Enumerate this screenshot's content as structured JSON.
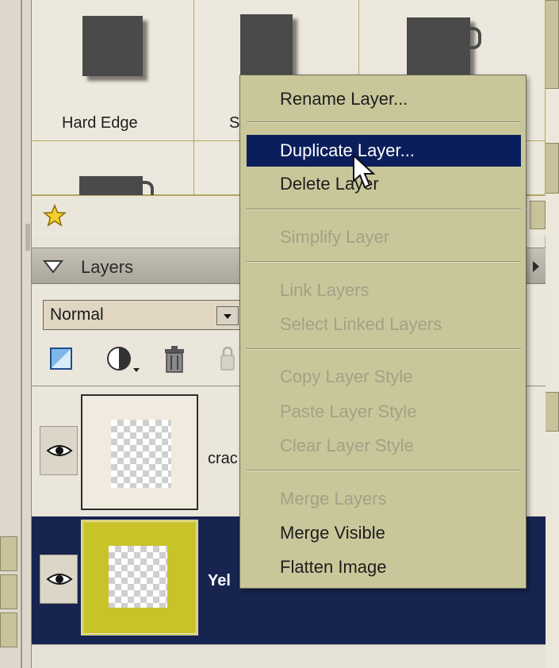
{
  "styles_panel": {
    "items": [
      {
        "label": "Hard Edge"
      },
      {
        "label": "S"
      },
      {
        "label": ""
      }
    ]
  },
  "layers_panel": {
    "title": "Layers",
    "blend_mode": "Normal",
    "tool_icons": [
      "new-layer-icon",
      "adjustment-layer-icon",
      "trash-icon",
      "lock-icon"
    ],
    "layers": [
      {
        "name": "crac",
        "visible": true,
        "selected": false
      },
      {
        "name": "Yel",
        "visible": true,
        "selected": true
      }
    ]
  },
  "context_menu": {
    "items": [
      {
        "label": "Rename Layer...",
        "enabled": true
      },
      {
        "label": "Duplicate Layer...",
        "enabled": true,
        "highlighted": true
      },
      {
        "label": "Delete Layer",
        "enabled": true
      },
      {
        "label": "Simplify Layer",
        "enabled": false
      },
      {
        "label": "Link Layers",
        "enabled": false
      },
      {
        "label": "Select Linked Layers",
        "enabled": false
      },
      {
        "label": "Copy Layer Style",
        "enabled": false
      },
      {
        "label": "Paste Layer Style",
        "enabled": false
      },
      {
        "label": "Clear Layer Style",
        "enabled": false
      },
      {
        "label": "Merge Layers",
        "enabled": false
      },
      {
        "label": "Merge Visible",
        "enabled": true
      },
      {
        "label": "Flatten Image",
        "enabled": true
      }
    ]
  },
  "colors": {
    "menu_bg": "#c9c79a",
    "highlight": "#0b1e5c",
    "selected_row": "#17244f",
    "grid_line": "#b3a75a",
    "layer_thumb_yellow": "#c9c32a"
  }
}
